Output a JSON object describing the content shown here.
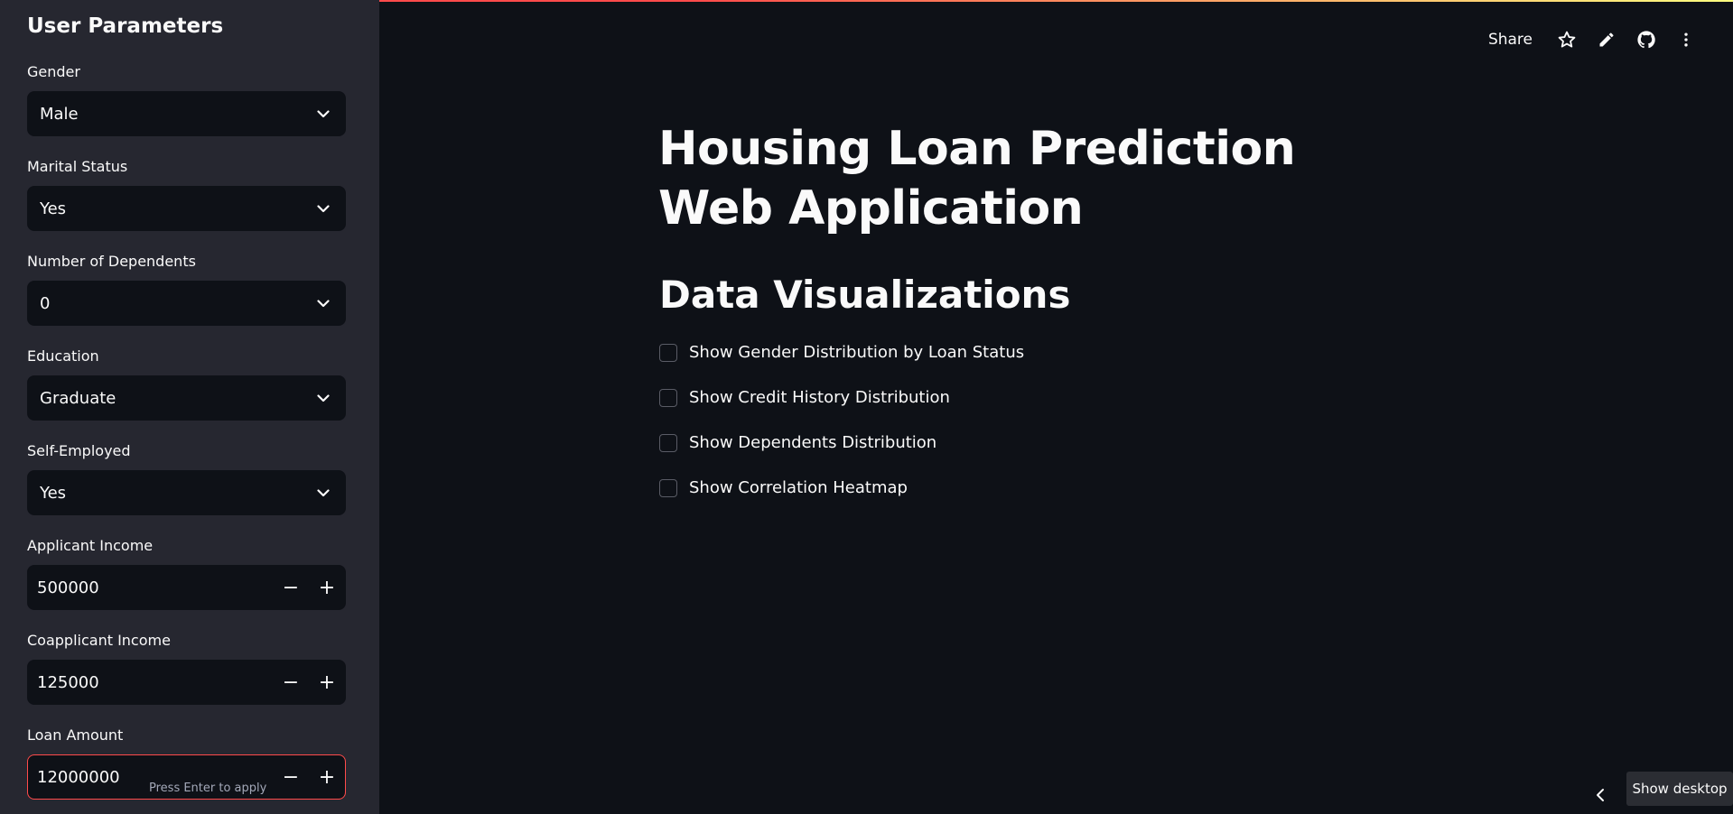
{
  "sidebar": {
    "title": "User Parameters",
    "fields": {
      "gender": {
        "label": "Gender",
        "value": "Male"
      },
      "marital": {
        "label": "Marital Status",
        "value": "Yes"
      },
      "dependents": {
        "label": "Number of Dependents",
        "value": "0"
      },
      "education": {
        "label": "Education",
        "value": "Graduate"
      },
      "self_employed": {
        "label": "Self-Employed",
        "value": "Yes"
      },
      "applicant_income": {
        "label": "Applicant Income",
        "value": "500000"
      },
      "coapplicant_income": {
        "label": "Coapplicant Income",
        "value": "125000"
      },
      "loan_amount": {
        "label": "Loan Amount",
        "value": "12000000"
      }
    },
    "press_hint": "Press Enter to apply",
    "minus": "−",
    "plus": "+"
  },
  "header": {
    "share_label": "Share",
    "icons": [
      "star-icon",
      "pencil-icon",
      "github-icon",
      "more-vert-icon"
    ]
  },
  "main": {
    "title": "Housing Loan Prediction Web Application",
    "section_title": "Data Visualizations",
    "checkboxes": [
      {
        "label": "Show Gender Distribution by Loan Status",
        "checked": false
      },
      {
        "label": "Show Credit History Distribution",
        "checked": false
      },
      {
        "label": "Show Dependents Distribution",
        "checked": false
      },
      {
        "label": "Show Correlation Heatmap",
        "checked": false
      }
    ]
  },
  "taskbar": {
    "show_desktop": "Show desktop"
  },
  "colors": {
    "background": "#0e1117",
    "sidebar": "#262730",
    "accent": "#ff4b4b",
    "text": "#fafafa"
  }
}
